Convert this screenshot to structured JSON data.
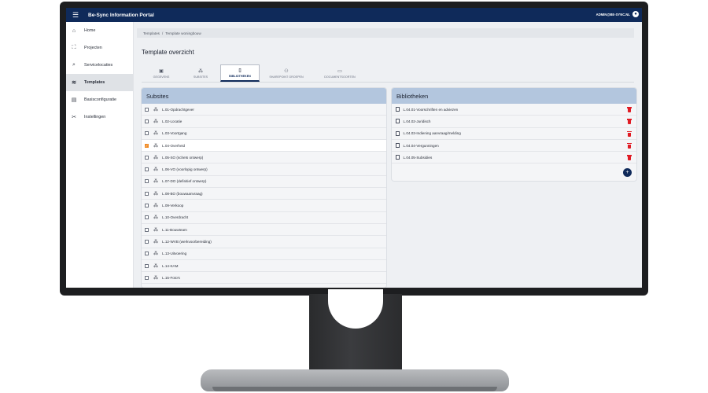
{
  "app": {
    "title": "Be-Sync Information Portal",
    "user": "ADMIN@BE-SYNC.NL",
    "menu_icon": "☰"
  },
  "sidebar": {
    "items": [
      {
        "label": "Home",
        "icon": "⌂",
        "active": false
      },
      {
        "label": "Projecten",
        "icon": "⛶",
        "active": false
      },
      {
        "label": "Servicelocaties",
        "icon": "⌕",
        "active": false
      },
      {
        "label": "Templates",
        "icon": "≋",
        "active": true
      },
      {
        "label": "Basisconfiguratie",
        "icon": "▤",
        "active": false
      },
      {
        "label": "Instellingen",
        "icon": "✂",
        "active": false
      }
    ]
  },
  "breadcrumb": {
    "root": "Templates",
    "separator": "/",
    "current": "Template woningbouw"
  },
  "page": {
    "title": "Template overzicht"
  },
  "tabs": [
    {
      "label": "GEGEVENS",
      "icon": "▣"
    },
    {
      "label": "SUBSITES",
      "icon": "⁂"
    },
    {
      "label": "BIBLIOTHEKEN",
      "icon": "▯"
    },
    {
      "label": "SHAREPOINT GROEPEN",
      "icon": "⚇"
    },
    {
      "label": "DOCUMENTSOORTEN",
      "icon": "▭"
    }
  ],
  "subsites": {
    "title": "Subsites",
    "items": [
      {
        "label": "L.01-Opdrachtgever",
        "checked": false
      },
      {
        "label": "L.02-Locatie",
        "checked": false
      },
      {
        "label": "L.03-Voortgang",
        "checked": false
      },
      {
        "label": "L.04-Overheid",
        "checked": true
      },
      {
        "label": "L.05-SO (schets ontwerp)",
        "checked": false
      },
      {
        "label": "L.06-VO (voorlopig ontwerp)",
        "checked": false
      },
      {
        "label": "L.07-DO (definitief ontwerp)",
        "checked": false
      },
      {
        "label": "L.08-BO (bouwaanvraag)",
        "checked": false
      },
      {
        "label": "L.09-Verkoop",
        "checked": false
      },
      {
        "label": "L.10-Overdracht",
        "checked": false
      },
      {
        "label": "L.11-Bouwteam",
        "checked": false
      },
      {
        "label": "L.12-WVB (werkvoorbereiding)",
        "checked": false
      },
      {
        "label": "L.13-Uitvoering",
        "checked": false
      },
      {
        "label": "L.14-KAM",
        "checked": false
      },
      {
        "label": "L.15-Foto's",
        "checked": false
      }
    ]
  },
  "bibliotheken": {
    "title": "Bibliotheken",
    "items": [
      {
        "label": "L.04.01-Voorschriften en adviezen"
      },
      {
        "label": "L.04.02-Juridisch"
      },
      {
        "label": "L.04.03-Indiening aanvraag/melding"
      },
      {
        "label": "L.04.04-Vergunningen"
      },
      {
        "label": "L.04.05-Subsidies"
      }
    ],
    "add_icon": "+"
  },
  "colors": {
    "topbar": "#0f2a5a",
    "panel_header": "#b3c6de",
    "checkbox_on": "#f08a24",
    "trash": "#e01b24"
  }
}
